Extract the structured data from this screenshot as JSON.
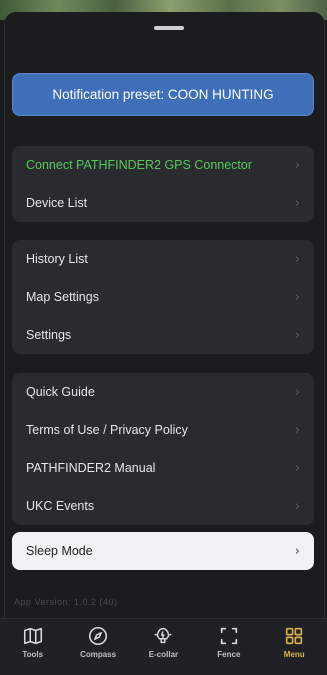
{
  "sheet": {
    "preset_banner": "Notification preset: COON HUNTING"
  },
  "groups": [
    {
      "items": [
        {
          "label": "Connect PATHFINDER2 GPS Connector",
          "accent": "green"
        },
        {
          "label": "Device List"
        }
      ]
    },
    {
      "items": [
        {
          "label": "History List"
        },
        {
          "label": "Map Settings"
        },
        {
          "label": "Settings"
        }
      ]
    },
    {
      "items": [
        {
          "label": "Quick Guide"
        },
        {
          "label": "Terms of Use / Privacy Policy"
        },
        {
          "label": "PATHFINDER2 Manual"
        },
        {
          "label": "UKC Events"
        }
      ]
    }
  ],
  "sleep_mode": {
    "label": "Sleep Mode"
  },
  "version_text": "App Version: 1.0.2 (40)",
  "chevron": "›",
  "tabbar": {
    "tabs": [
      {
        "label": "Tools",
        "icon": "map-icon"
      },
      {
        "label": "Compass",
        "icon": "compass-icon"
      },
      {
        "label": "E-collar",
        "icon": "ecollar-icon"
      },
      {
        "label": "Fence",
        "icon": "fence-icon"
      },
      {
        "label": "Menu",
        "icon": "grid-icon",
        "active": true
      }
    ],
    "active_color": "#d6b24a"
  },
  "colors": {
    "banner_blue": "#3f6fb8",
    "connect_green": "#56c85c"
  }
}
